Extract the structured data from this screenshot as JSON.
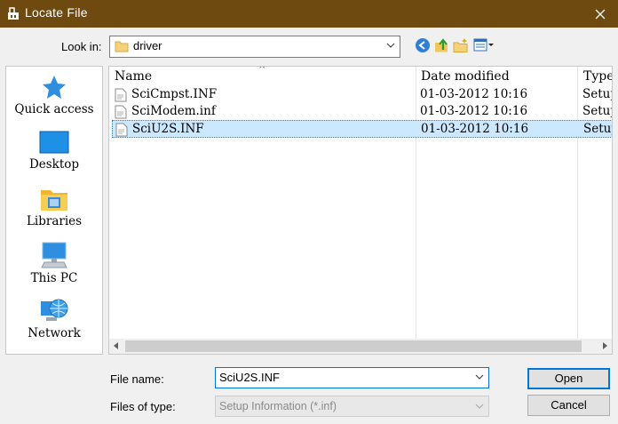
{
  "window": {
    "title": "Locate File"
  },
  "toolbar": {
    "lookin_label": "Look in:",
    "lookin_value": "driver"
  },
  "places": [
    {
      "label": "Quick access",
      "icon": "star-icon"
    },
    {
      "label": "Desktop",
      "icon": "desktop-icon"
    },
    {
      "label": "Libraries",
      "icon": "libraries-icon"
    },
    {
      "label": "This PC",
      "icon": "computer-icon"
    },
    {
      "label": "Network",
      "icon": "network-icon"
    }
  ],
  "columns": {
    "name": "Name",
    "date": "Date modified",
    "type": "Type"
  },
  "files": [
    {
      "name": "SciCmpst.INF",
      "date": "01-03-2012 10:16",
      "type": "Setup"
    },
    {
      "name": "SciModem.inf",
      "date": "01-03-2012 10:16",
      "type": "Setup"
    },
    {
      "name": "SciU2S.INF",
      "date": "01-03-2012 10:16",
      "type": "Setup",
      "selected": true
    }
  ],
  "filename": {
    "label": "File name:",
    "value": "SciU2S.INF"
  },
  "filetype": {
    "label": "Files of type:",
    "value": "Setup Information (*.inf)"
  },
  "buttons": {
    "open": "Open",
    "cancel": "Cancel"
  },
  "colors": {
    "titlebar": "#6e4a10",
    "selection": "#cce8ff",
    "accent": "#0078d7"
  }
}
